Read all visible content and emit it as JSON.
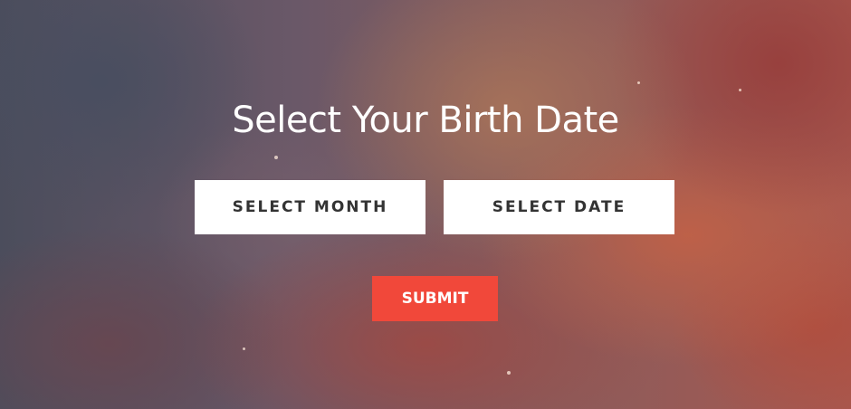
{
  "page": {
    "title": "Select Your Birth Date"
  },
  "form": {
    "month_select": {
      "value": "SELECT MONTH"
    },
    "date_select": {
      "value": "SELECT DATE"
    },
    "submit_label": "SUBMIT"
  },
  "colors": {
    "submit_button": "#f1483a",
    "select_background": "#ffffff",
    "select_text": "#333333",
    "title_text": "#ffffff"
  }
}
